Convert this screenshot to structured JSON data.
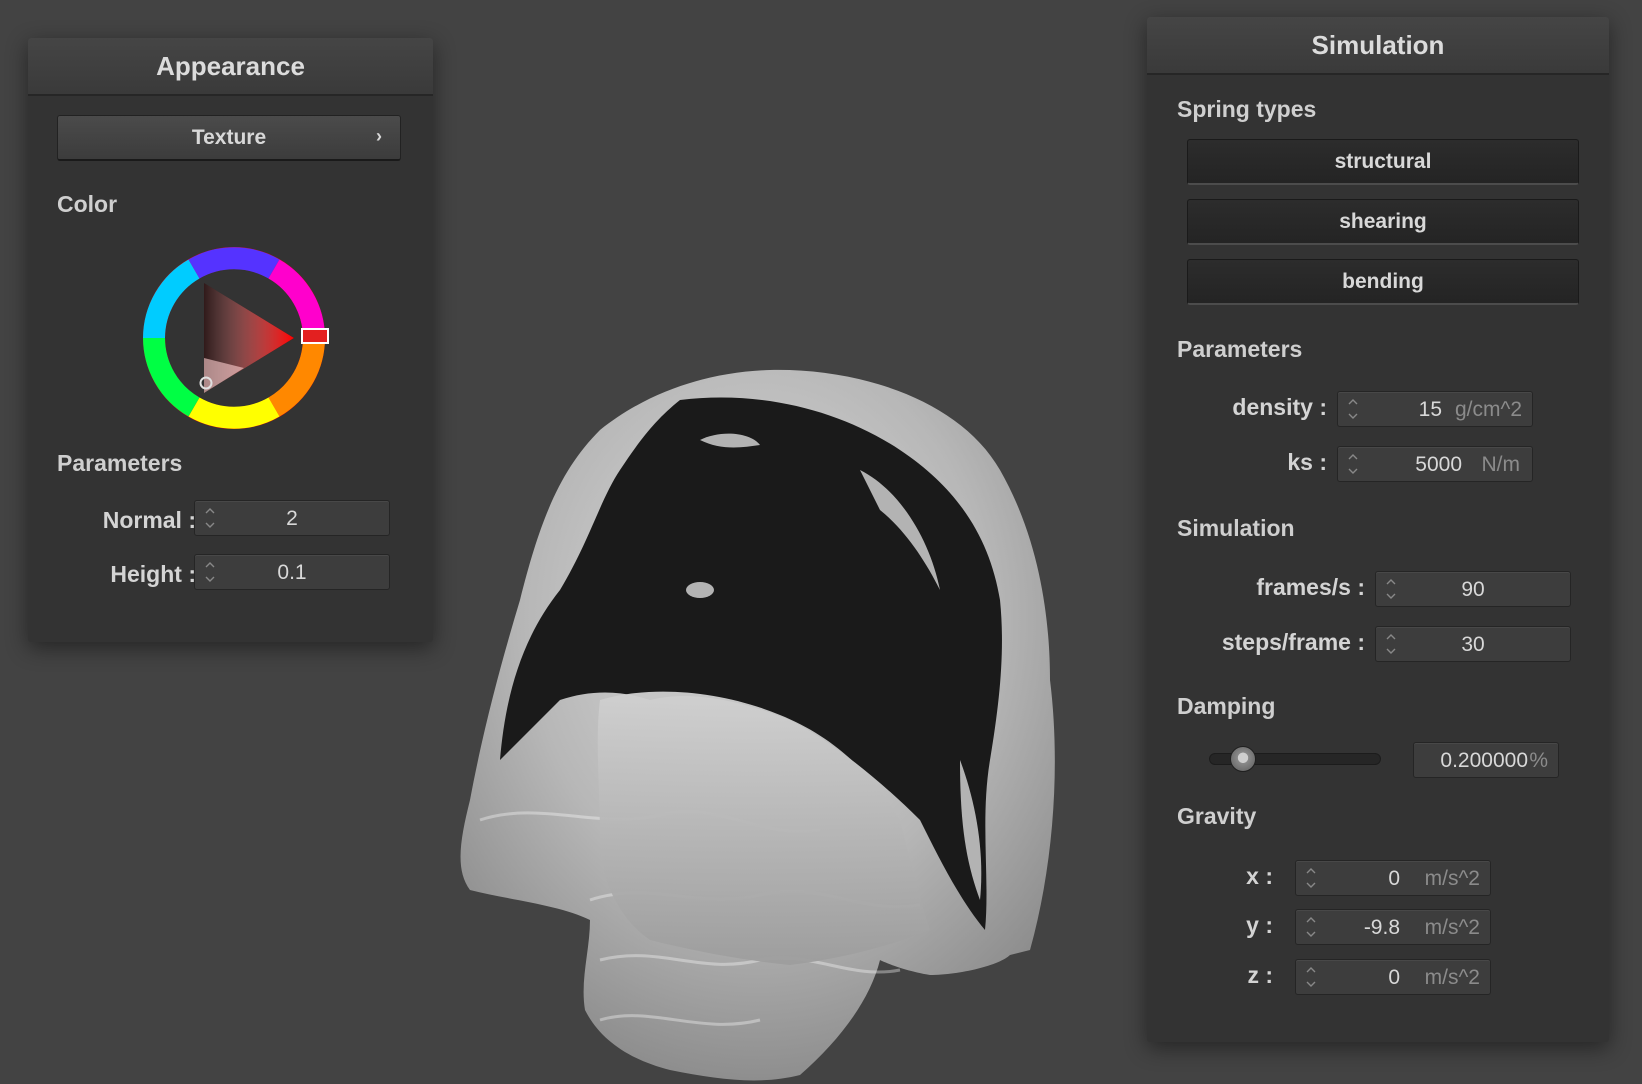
{
  "appearance": {
    "title": "Appearance",
    "texture_button": "Texture",
    "texture_chevron": "›",
    "color_label": "Color",
    "parameters_label": "Parameters",
    "selected_color": "#ff0000",
    "normal": {
      "label": "Normal :",
      "value": "2"
    },
    "height": {
      "label": "Height :",
      "value": "0.1"
    }
  },
  "simulation": {
    "title": "Simulation",
    "spring_types_label": "Spring types",
    "spring_buttons": [
      "structural",
      "shearing",
      "bending"
    ],
    "parameters_label": "Parameters",
    "density": {
      "label": "density :",
      "value": "15",
      "unit": "g/cm^2"
    },
    "ks": {
      "label": "ks :",
      "value": "5000",
      "unit": "N/m"
    },
    "simulation_label": "Simulation",
    "fps": {
      "label": "frames/s :",
      "value": "90"
    },
    "steps": {
      "label": "steps/frame :",
      "value": "30"
    },
    "damping_label": "Damping",
    "damping": {
      "value": "0.200000",
      "unit": "%",
      "slider_fraction": 0.2
    },
    "gravity_label": "Gravity",
    "gravity": {
      "x": {
        "label": "x :",
        "value": "0",
        "unit": "m/s^2"
      },
      "y": {
        "label": "y :",
        "value": "-9.8",
        "unit": "m/s^2"
      },
      "z": {
        "label": "z :",
        "value": "0",
        "unit": "m/s^2"
      }
    }
  }
}
